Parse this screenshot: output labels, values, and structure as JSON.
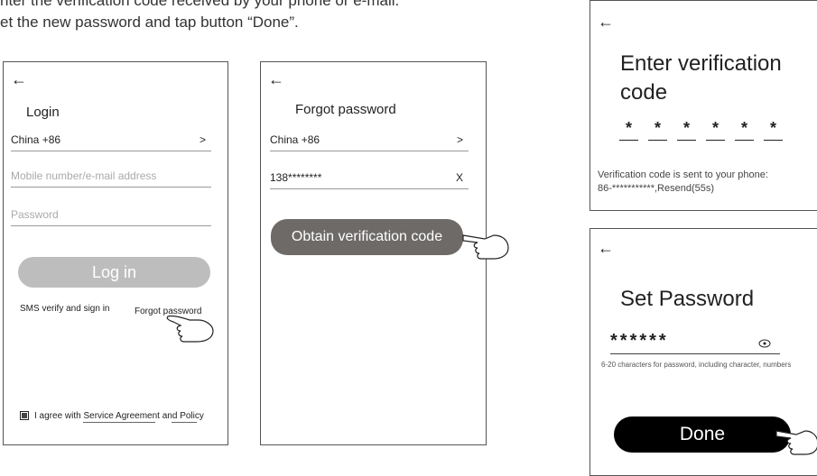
{
  "intro": {
    "line1": "nter the verification code received by your phone or e-mail.",
    "line2": "et the new password and tap button “Done”."
  },
  "login": {
    "back": "←",
    "title": "Login",
    "country": "China +86",
    "country_chevron": ">",
    "mobile_placeholder": "Mobile number/e-mail address",
    "password_placeholder": "Password",
    "login_button": "Log in",
    "sms_link": "SMS verify and sign in",
    "forgot_link": "Forgot password",
    "agree_text": "I agree with Service Agreement and Policy"
  },
  "forgot": {
    "back": "←",
    "title": "Forgot password",
    "country": "China +86",
    "country_chevron": ">",
    "phone_value": "138********",
    "clear": "X",
    "obtain_button": "Obtain verification code"
  },
  "verify": {
    "back": "←",
    "title_line1": "Enter verification",
    "title_line2": "code",
    "code_digits": [
      "*",
      "*",
      "*",
      "*",
      "*",
      "*"
    ],
    "note_line1": "Verification code is sent to your phone:",
    "note_line2": "86-***********,Resend(55s)"
  },
  "setpw": {
    "back": "←",
    "title": "Set Password",
    "password_value": "******",
    "eye_icon": "eye-icon",
    "hint": "6-20 characters for password, including character, numbers",
    "done_button": "Done"
  }
}
